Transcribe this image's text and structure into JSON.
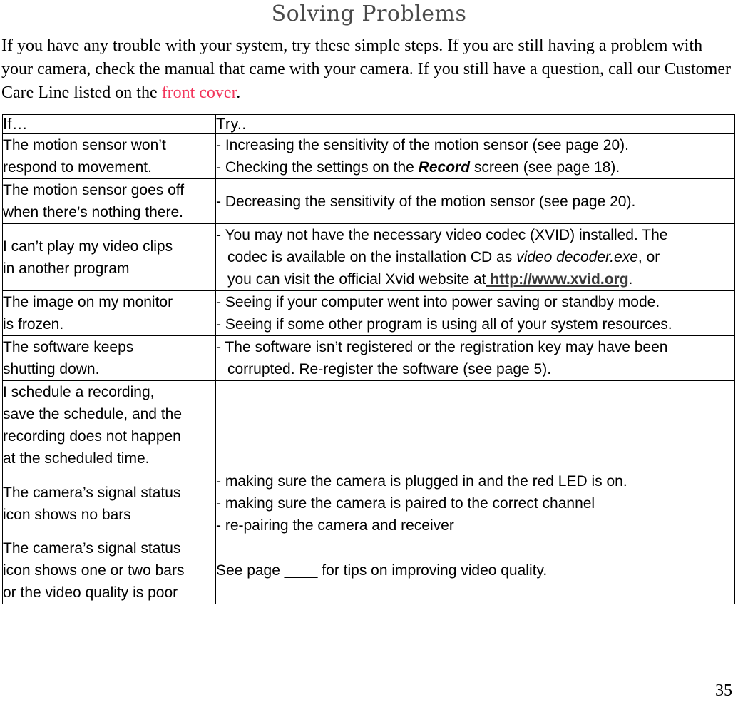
{
  "document": {
    "title": "Solving Problems",
    "page_number": "35",
    "intro": {
      "text_before_link": "If you have any trouble with your system, try these simple steps. If you are still having a problem with your camera, check the manual that came with your camera. If you still have a question, call our Customer Care Line listed on the ",
      "link_text": "front cover",
      "text_after_link": ".",
      "link_color": "#f2355b"
    }
  },
  "table": {
    "headers": {
      "if": "If…",
      "try": "Try.."
    },
    "rows": [
      {
        "if": [
          "The motion sensor won’t",
          "respond to movement."
        ],
        "try_lines": [
          "- Increasing the sensitivity of the motion sensor (see page 20).",
          "- Checking the settings on the Record screen (see page 18)."
        ],
        "try_emphasis": "Record",
        "try_valign": "top"
      },
      {
        "if": [
          "The motion sensor goes off",
          "when there’s nothing there."
        ],
        "try_lines": [
          "- Decreasing the sensitivity of the motion sensor (see page 20)."
        ],
        "try_valign": "middle"
      },
      {
        "if": [
          "I can’t play my video clips",
          "in another program"
        ],
        "try_lines": [
          "- You may not have the necessary video codec (XVID) installed. The",
          "codec is available on the installation CD as video decoder.exe, or",
          "you can visit the official Xvid website at http://www.xvid.org."
        ],
        "try_italic": "video decoder.exe",
        "try_url": "http://www.xvid.org",
        "try_valign": "top"
      },
      {
        "if": [
          "The image on my monitor",
          "is frozen."
        ],
        "try_lines": [
          "- Seeing if your computer went into power saving or standby mode.",
          "- Seeing if some other program is using all of your system resources."
        ],
        "try_valign": "top"
      },
      {
        "if": [
          "The software keeps",
          "shutting down."
        ],
        "try_lines": [
          "- The software isn’t registered or the registration key may have been",
          "corrupted. Re-register the software (see page 5)."
        ],
        "try_valign": "top"
      },
      {
        "if": [
          "I schedule a recording,",
          "save the schedule, and the",
          "recording does not happen",
          "at the scheduled time."
        ],
        "try_lines": [],
        "try_valign": "top"
      },
      {
        "if": [
          "The camera’s signal status",
          "icon shows no bars"
        ],
        "try_lines": [
          "- making sure the camera is plugged in and the red LED is on.",
          "- making sure the camera is paired to the correct channel",
          "- re-pairing the camera and receiver"
        ],
        "try_valign": "top"
      },
      {
        "if": [
          "The camera’s signal status",
          "icon shows one or two bars",
          "or the video quality is poor"
        ],
        "try_lines": [
          "See page ____ for tips on improving video quality."
        ],
        "try_valign": "middle"
      }
    ]
  }
}
